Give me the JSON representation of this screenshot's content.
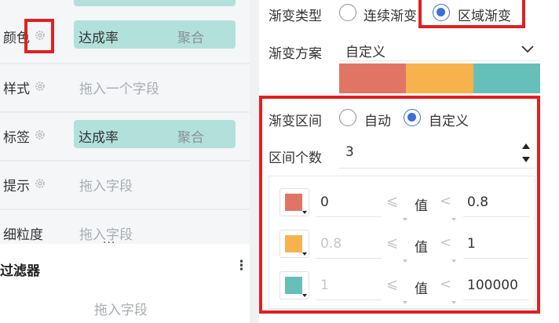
{
  "left": {
    "rows": [
      {
        "label": "颜色",
        "pill": {
          "name": "达成率",
          "agg": "聚合"
        }
      },
      {
        "label": "样式",
        "drop_hint": "拖入一个字段"
      },
      {
        "label": "标签",
        "pill": {
          "name": "达成率",
          "agg": "聚合"
        }
      },
      {
        "label": "提示",
        "drop_hint": "拖入字段"
      },
      {
        "label": "细粒度",
        "drop_hint": "拖入字段"
      }
    ],
    "resize_handle": "···",
    "filter": {
      "title": "过滤器",
      "more": "⋮",
      "drop_hint": "拖入字段"
    }
  },
  "right": {
    "gradient_type": {
      "label": "渐变类型",
      "options": [
        "连续渐变",
        "区域渐变"
      ],
      "selected": "区域渐变"
    },
    "gradient_scheme": {
      "label": "渐变方案",
      "value": "自定义",
      "colors": [
        "#e07566",
        "#f7b24e",
        "#66bfb9"
      ]
    },
    "interval_mode": {
      "label": "渐变区间",
      "options": [
        "自动",
        "自定义"
      ],
      "selected": "自定义"
    },
    "interval_count": {
      "label": "区间个数",
      "value": "3"
    },
    "ranges": [
      {
        "color": "#e07566",
        "from": "0",
        "from_disabled": false,
        "op1": "⩽",
        "value_word": "值",
        "op2": "<",
        "to": "0.8"
      },
      {
        "color": "#f7b24e",
        "from": "0.8",
        "from_disabled": true,
        "op1": "⩽",
        "value_word": "值",
        "op2": "<",
        "to": "1"
      },
      {
        "color": "#66bfb9",
        "from": "1",
        "from_disabled": true,
        "op1": "⩽",
        "value_word": "值",
        "op2": "<",
        "to": "100000"
      }
    ]
  },
  "highlight_color": "#e02020",
  "accent_color": "#3b6fd9"
}
